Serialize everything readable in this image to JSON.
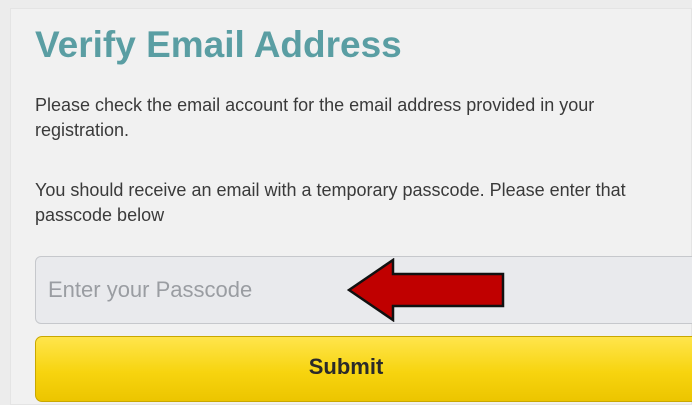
{
  "page": {
    "title": "Verify Email Address",
    "paragraph1": "Please check the email account for the email address provided in your registration.",
    "paragraph2": "You should receive an email with a temporary passcode. Please enter that passcode below"
  },
  "form": {
    "passcode_placeholder": "Enter your Passcode",
    "passcode_value": "",
    "submit_label": "Submit"
  },
  "annotation": {
    "arrow_color": "#c00000",
    "arrow_direction": "left"
  },
  "colors": {
    "title": "#5a9ea3",
    "button": "#f7d40f"
  },
  "icons": [
    "red-arrow-icon"
  ]
}
